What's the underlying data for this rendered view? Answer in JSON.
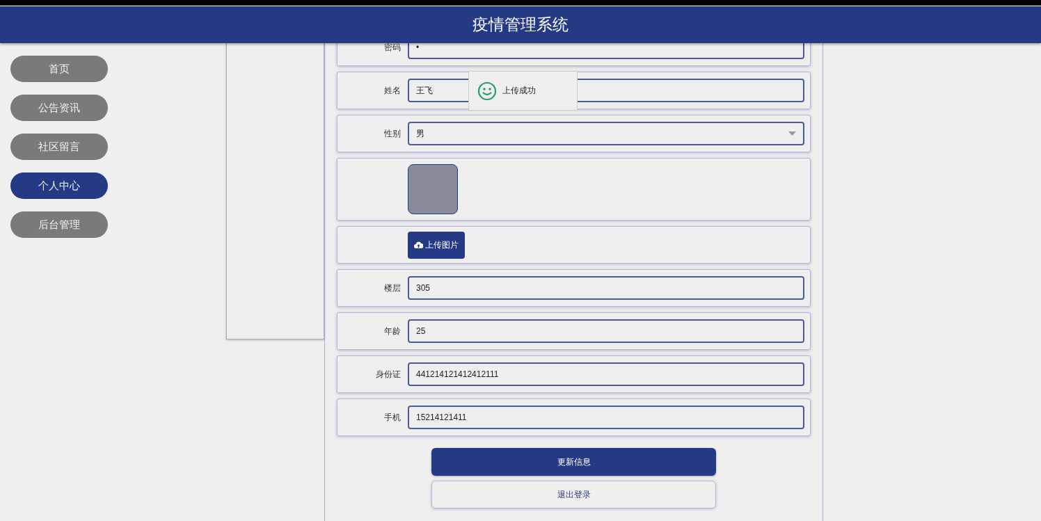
{
  "header": {
    "title": "疫情管理系统"
  },
  "nav": [
    {
      "label": "首页",
      "selected": false
    },
    {
      "label": "公告资讯",
      "selected": false
    },
    {
      "label": "社区留言",
      "selected": false
    },
    {
      "label": "个人中心",
      "selected": true
    },
    {
      "label": "后台管理",
      "selected": false
    }
  ],
  "form": {
    "fields": [
      {
        "kind": "text",
        "label": "密码",
        "value": "•"
      },
      {
        "kind": "text",
        "label": "姓名",
        "value": "王飞"
      },
      {
        "kind": "select",
        "label": "性别",
        "value": "男"
      },
      {
        "kind": "photo"
      },
      {
        "kind": "upload",
        "button": "上传图片"
      },
      {
        "kind": "text",
        "label": "楼层",
        "value": "305"
      },
      {
        "kind": "text",
        "label": "年龄",
        "value": "25"
      },
      {
        "kind": "text",
        "label": "身份证",
        "value": "441214121412412111"
      },
      {
        "kind": "text",
        "label": "手机",
        "value": "15214121411"
      }
    ]
  },
  "buttons": [
    {
      "kind": "primary",
      "label": "更新信息"
    },
    {
      "kind": "secondary",
      "label": "退出登录"
    }
  ],
  "toast": {
    "message": "上传成功"
  }
}
